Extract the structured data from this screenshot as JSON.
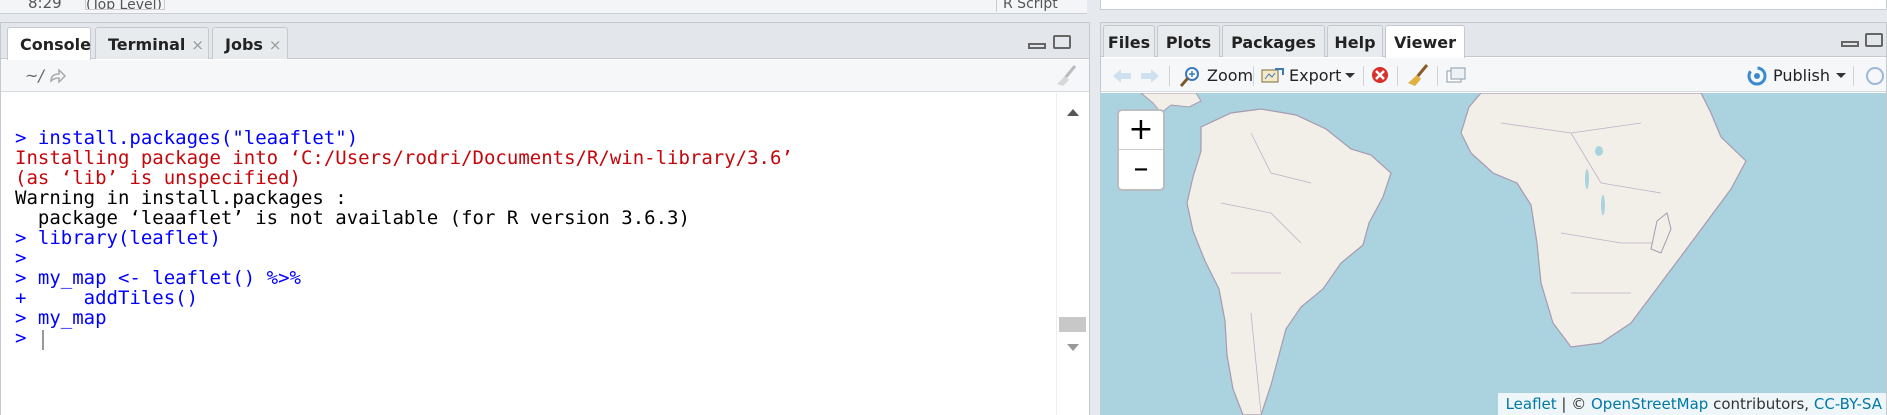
{
  "top": {
    "line_num": "8:29",
    "scope": "(Top Level)",
    "file_type": "R Script"
  },
  "console": {
    "tabs": [
      {
        "label": "Console"
      },
      {
        "label": "Terminal"
      },
      {
        "label": "Jobs"
      }
    ],
    "close_glyph": "×",
    "path": "~/",
    "lines": [
      {
        "text": "> install.packages(\"leaaflet\")"
      },
      {
        "text": "Installing package into ‘C:/Users/rodri/Documents/R/win-library/3.6’"
      },
      {
        "text": "(as ‘lib’ is unspecified)"
      },
      {
        "text": "Warning in install.packages :"
      },
      {
        "text": "  package ‘leaaflet’ is not available (for R version 3.6.3)"
      },
      {
        "text": "> library(leaflet)"
      },
      {
        "text": ">"
      },
      {
        "text": "> my_map <- leaflet() %>%"
      },
      {
        "text": "+     addTiles()"
      },
      {
        "text": "> my_map"
      },
      {
        "text": ">"
      }
    ]
  },
  "viewer": {
    "tabs": [
      {
        "label": "Files"
      },
      {
        "label": "Plots"
      },
      {
        "label": "Packages"
      },
      {
        "label": "Help"
      },
      {
        "label": "Viewer"
      }
    ],
    "toolbar": {
      "zoom": "Zoom",
      "export": "Export",
      "publish": "Publish"
    },
    "map": {
      "zoom_in": "+",
      "zoom_out": "–",
      "attribution": {
        "leaflet": "Leaflet",
        "sep": " | © ",
        "osm": "OpenStreetMap",
        "contrib": " contributors, ",
        "license": "CC-BY-SA"
      }
    }
  },
  "colors": {
    "prompt_blue": "#0000ff",
    "error_red": "#c5060b",
    "water": "#aad3df",
    "land": "#f2efe9",
    "link": "#0078a8"
  },
  "icons": [
    "back-arrow-icon",
    "forward-arrow-icon",
    "zoom-icon",
    "export-icon",
    "clear-icon",
    "broom-icon",
    "popout-icon",
    "publish-icon",
    "chevron-down-icon"
  ]
}
